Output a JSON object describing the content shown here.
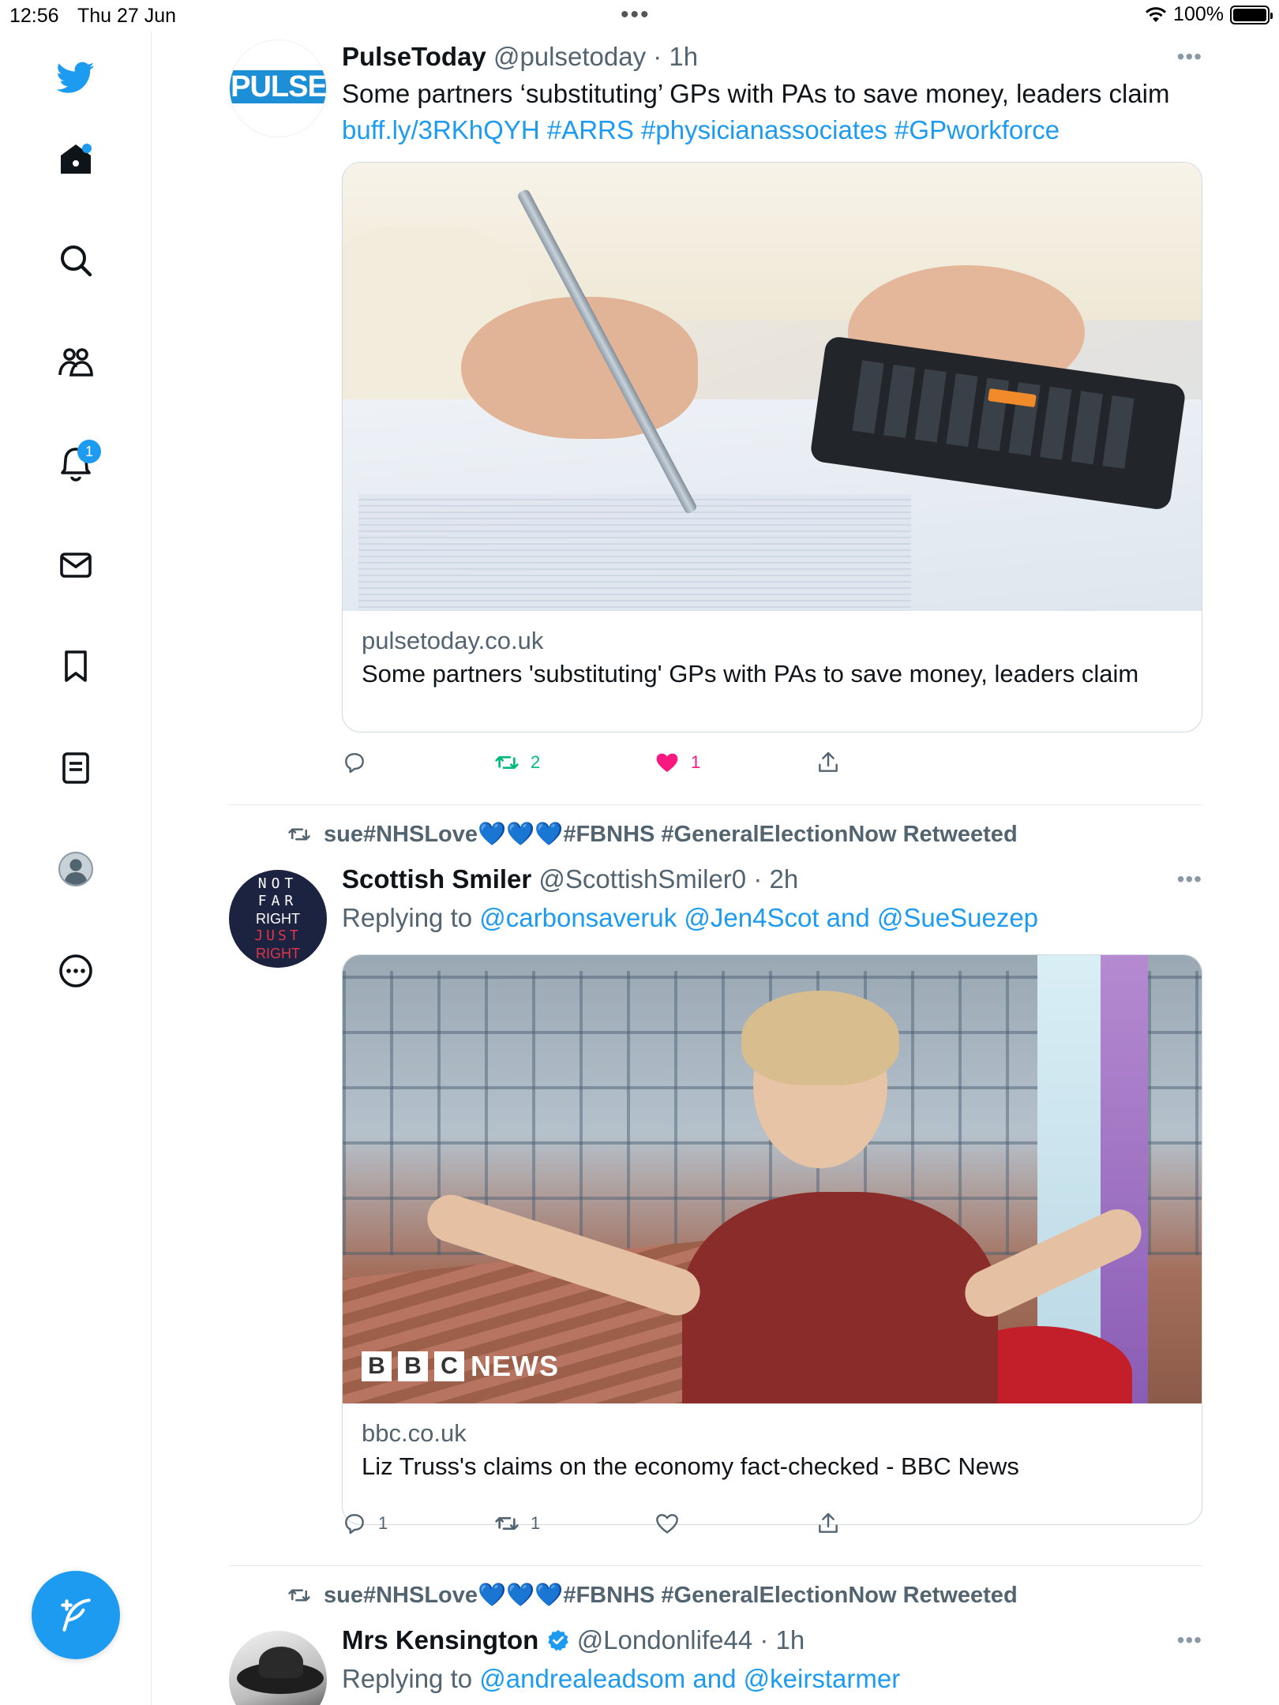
{
  "status_bar": {
    "time": "12:56",
    "date": "Thu 27 Jun",
    "battery": "100%"
  },
  "sidebar": {
    "items": [
      {
        "name": "twitter-logo-icon"
      },
      {
        "name": "home-icon",
        "has_dot": true
      },
      {
        "name": "search-icon"
      },
      {
        "name": "communities-icon"
      },
      {
        "name": "notifications-icon",
        "badge": "1"
      },
      {
        "name": "messages-icon"
      },
      {
        "name": "bookmarks-icon"
      },
      {
        "name": "lists-icon"
      },
      {
        "name": "profile-icon"
      },
      {
        "name": "more-icon"
      }
    ],
    "compose_icon": "compose-tweet-icon",
    "accent": "#1d9bf0"
  },
  "tweets": [
    {
      "avatar_text": "PULSE",
      "name": "PulseToday",
      "handle": "@pulsetoday",
      "time": "1h",
      "text_plain": "Some partners ‘substituting’ GPs with PAs to save money, leaders claim",
      "text_link": "buff.ly/3RKhQYH #ARRS #physicianassociates #GPworkforce",
      "card_domain": "pulsetoday.co.uk",
      "card_title": "Some partners 'substituting' GPs with PAs to save money, leaders claim",
      "replies": "",
      "retweets": "2",
      "likes": "1",
      "retweet_color": "#00ba7c",
      "like_color": "#f91880"
    },
    {
      "retweeted_by": "sue#NHSLove💙💙💙#FBNHS #GeneralElectionNow Retweeted",
      "avatar_lines": [
        "NOT",
        "FAR",
        "RIGHT",
        "JUST",
        "RIGHT"
      ],
      "name": "Scottish Smiler",
      "handle": "@ScottishSmiler0",
      "time": "2h",
      "replying_label": "Replying to",
      "replying_to": "@carbonsaveruk @Jen4Scot and @SueSuezep",
      "card_overlay": "BBC NEWS",
      "card_domain": "bbc.co.uk",
      "card_title": "Liz Truss's claims on the economy fact-checked - BBC News",
      "replies": "1",
      "retweets": "1",
      "likes": ""
    },
    {
      "retweeted_by": "sue#NHSLove💙💙💙#FBNHS #GeneralElectionNow Retweeted",
      "name": "Mrs Kensington",
      "verified": true,
      "handle": "@Londonlife44",
      "time": "1h",
      "replying_label": "Replying to",
      "replying_to": "@andrealeadsom and @keirstarmer"
    }
  ]
}
